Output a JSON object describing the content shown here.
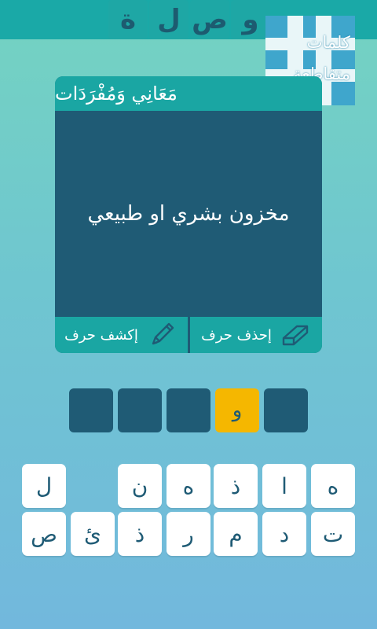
{
  "header": {
    "logo_letters": [
      "و",
      "ص",
      "ل",
      "ة"
    ],
    "app_logo": {
      "line1": "كلمات",
      "line2": "متقاطعة"
    }
  },
  "card": {
    "title": "مَعَانِي وَمُفْرَدَات",
    "clue": "مخزون بشري او طبيعي",
    "remove_letter_label": "إحذف حرف",
    "reveal_letter_label": "إكشف حرف"
  },
  "answer": {
    "slots": [
      "",
      "",
      "",
      "و",
      ""
    ],
    "filled_index": 3
  },
  "keyboard": {
    "row1": [
      "ه",
      "ا",
      "ذ",
      "ه",
      "ن",
      "",
      "ل"
    ],
    "row2": [
      "ت",
      "د",
      "م",
      "ر",
      "ذ",
      "ئ",
      "ص"
    ]
  },
  "colors": {
    "dark_teal": "#1f5b75",
    "teal": "#1aa6a3",
    "accent_yellow": "#f5b700"
  }
}
